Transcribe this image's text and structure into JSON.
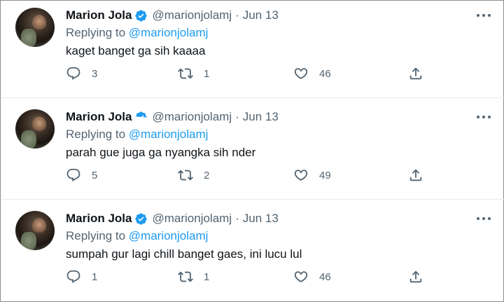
{
  "tweets": [
    {
      "name": "Marion Jola",
      "handle": "@marionjolamj",
      "separator": "·",
      "date": "Jun 13",
      "replying_prefix": "Replying to ",
      "replying_to": "@marionjolamj",
      "text": "kaget banget ga sih kaaaa",
      "replies": "3",
      "retweets": "1",
      "likes": "46"
    },
    {
      "name": "Marion Jola",
      "handle": "@marionjolamj",
      "separator": "·",
      "date": "Jun 13",
      "replying_prefix": "Replying to ",
      "replying_to": "@marionjolamj",
      "text": "parah gue juga ga nyangka sih nder",
      "replies": "5",
      "retweets": "2",
      "likes": "49"
    },
    {
      "name": "Marion Jola",
      "handle": "@marionjolamj",
      "separator": "·",
      "date": "Jun 13",
      "replying_prefix": "Replying to ",
      "replying_to": "@marionjolamj",
      "text": "sumpah gur lagi chill banget gaes, ini lucu lul",
      "replies": "1",
      "retweets": "1",
      "likes": "46"
    }
  ],
  "colors": {
    "accent": "#1d9bf0",
    "secondary_text": "#536471",
    "primary_text": "#0f1419",
    "divider": "#e6ecf0"
  },
  "icons": {
    "verified": "verified-badge-icon",
    "more": "more-options-icon",
    "reply": "reply-icon",
    "retweet": "retweet-icon",
    "like": "heart-icon",
    "share": "share-icon"
  }
}
